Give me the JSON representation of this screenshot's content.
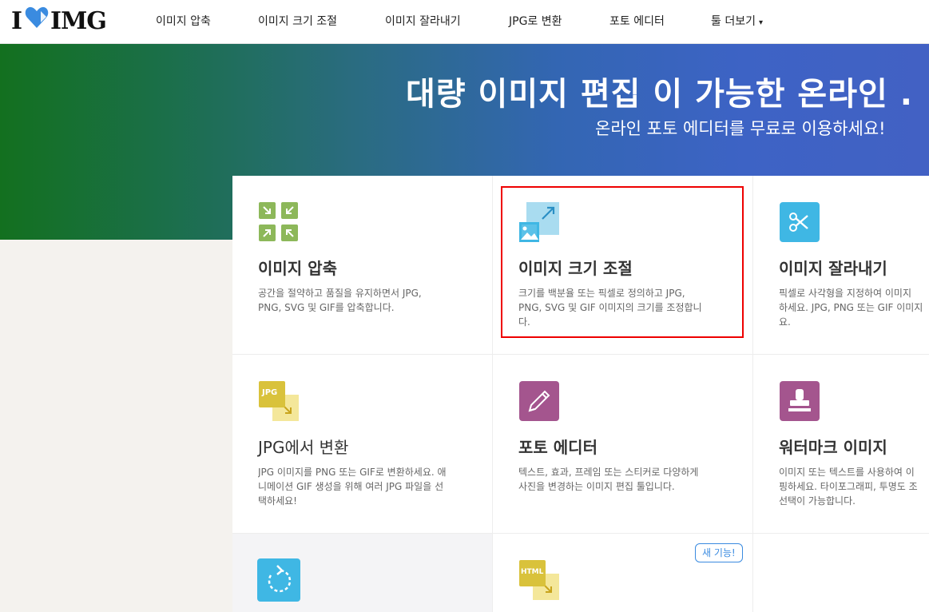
{
  "brand": {
    "logo_left": "I",
    "logo_right": "IMG",
    "heart_color": "#3a8be0"
  },
  "nav": {
    "items": [
      {
        "label": "이미지 압축"
      },
      {
        "label": "이미지 크기 조절"
      },
      {
        "label": "이미지 잘라내기"
      },
      {
        "label": "JPG로 변환"
      },
      {
        "label": "포토 에디터"
      },
      {
        "label": "툴 더보기"
      }
    ],
    "more_caret": "▾"
  },
  "hero": {
    "title": "대량 이미지 편집 이 가능한 온라인 .",
    "subtitle": "온라인 포토 에디터를 무료로 이용하세요!"
  },
  "tools": [
    {
      "title": "이미지 압축",
      "desc_line1": "공간을 절약하고 품질을 유지하면서 JPG,",
      "desc_line2": "PNG, SVG 및 GIF를 압축합니다.",
      "desc_line3": "",
      "icon": "compress-icon",
      "color": "#8db85a"
    },
    {
      "title": "이미지 크기 조절",
      "desc_line1": "크기를 백분율 또는 픽셀로 정의하고 JPG,",
      "desc_line2": "PNG, SVG 및 GIF 이미지의 크기를 조정합니",
      "desc_line3": "다.",
      "icon": "resize-icon",
      "color": "#3fb7e4"
    },
    {
      "title": "이미지 잘라내기",
      "desc_line1": "픽셀로 사각형을 지정하여 이미지",
      "desc_line2": "하세요. JPG, PNG 또는 GIF 이미지",
      "desc_line3": "요.",
      "icon": "scissors-icon",
      "color": "#3fb7e4"
    },
    {
      "title": "JPG에서 변환",
      "desc_line1": "JPG 이미지를 PNG 또는 GIF로 변환하세요. 애",
      "desc_line2": "니메이션 GIF 생성을 위해 여러 JPG 파일을 선",
      "desc_line3": "택하세요!",
      "icon": "jpg-convert-icon",
      "color": "#d9c23b"
    },
    {
      "title": "포토 에디터",
      "desc_line1": "텍스트, 효과, 프레임 또는 스티커로 다양하게",
      "desc_line2": "사진을 변경하는 이미지 편집 툴입니다.",
      "desc_line3": "",
      "icon": "pencil-icon",
      "color": "#a4558e"
    },
    {
      "title": "워터마크 이미지",
      "desc_line1": "이미지 또는 텍스트를 사용하여 이",
      "desc_line2": "핑하세요. 타이포그래피, 투명도 조",
      "desc_line3": "선택이 가능합니다.",
      "icon": "stamp-icon",
      "color": "#a4558e"
    },
    {
      "title": "",
      "desc_line1": "",
      "desc_line2": "",
      "desc_line3": "",
      "icon": "rotate-icon",
      "color": "#3fb7e4"
    },
    {
      "title": "",
      "desc_line1": "",
      "desc_line2": "",
      "desc_line3": "",
      "icon": "html-convert-icon",
      "color": "#d9c23b"
    }
  ],
  "new_badge": "새 기능!",
  "icon_text": {
    "jpg": "JPG",
    "html": "HTML"
  }
}
